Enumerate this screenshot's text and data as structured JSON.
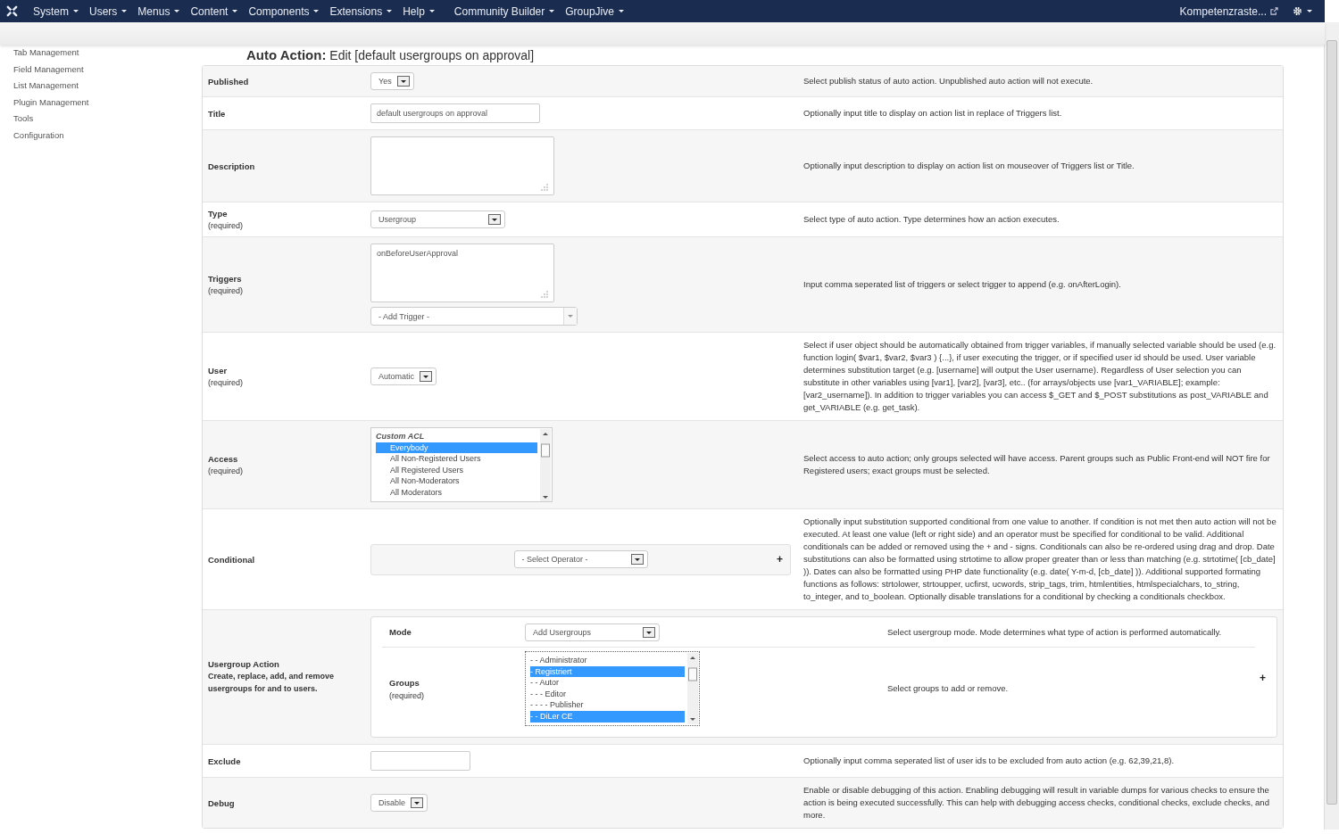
{
  "navbar": {
    "menus": [
      "System",
      "Users",
      "Menus",
      "Content",
      "Components",
      "Extensions",
      "Help",
      "Community Builder",
      "GroupJive"
    ],
    "site_link": "Kompetenzraste..."
  },
  "sidebar": {
    "items": [
      "Tab Management",
      "Field Management",
      "List Management",
      "Plugin Management",
      "Tools",
      "Configuration"
    ]
  },
  "page_title": "**Auto Action:** Edit [default usergroups on approval]",
  "rows": [
    {
      "kind": "select",
      "label": "Published",
      "value": "Yes",
      "help": "Select publish status of auto action. Unpublished auto action will not execute."
    },
    {
      "kind": "text",
      "label": "Title",
      "value": "default usergroups on approval",
      "help": "Optionally input title to display on action list in replace of Triggers list."
    },
    {
      "kind": "textarea",
      "label": "Description",
      "help": "Optionally input description to display on action list on mouseover of Triggers list or Title."
    },
    {
      "kind": "select",
      "label": "Type",
      "note": "(required)",
      "value": "Usergroup",
      "help": "Select type of auto action. Type determines how an action executes."
    },
    {
      "kind": "triggers",
      "label": "Triggers",
      "note": "(required)",
      "value": "onBeforeUserApproval",
      "select": "- Add Trigger -",
      "help": "Input comma seperated list of triggers or select trigger to append (e.g. onAfterLogin)."
    },
    {
      "kind": "select",
      "label": "User",
      "note": "(required)",
      "value": "Automatic",
      "help": "Select if user object should be automatically obtained from trigger variables, if manually selected variable should be used (e.g. function login( $var1, $var2, $var3 ) {...}, if user executing the trigger, or if specified user id should be used. User variable determines substitution target (e.g. [username] will output the User username). Regardless of User selection you can substitute in other variables using [var1], [var2], [var3], etc.. (for arrays/objects use [var1_VARIABLE]; example: [var2_username]). In addition to trigger variables you can access $_GET and $_POST substitutions as post_VARIABLE and get_VARIABLE (e.g. get_task)."
    },
    {
      "kind": "listbox",
      "label": "Access",
      "note": "(required)",
      "options": [
        {
          "text": "Custom ACL",
          "kind": "group",
          "selected": false
        },
        {
          "text": "Everybody",
          "kind": "option",
          "selected": true
        },
        {
          "text": "All Non-Registered Users",
          "kind": "option",
          "selected": false
        },
        {
          "text": "All Registered Users",
          "kind": "option",
          "selected": false
        },
        {
          "text": "All Non-Moderators",
          "kind": "option",
          "selected": false
        },
        {
          "text": "All Moderators",
          "kind": "option",
          "selected": false
        }
      ],
      "help": "Select access to auto action; only groups selected will have access. Parent groups such as Public Front-end will NOT fire for Registered users; exact groups must be selected."
    },
    {
      "kind": "conditional",
      "label": "Conditional",
      "value": "- Select Operator -",
      "add": "+",
      "help": "Optionally input substitution supported conditional from one value to another. If condition is not met then auto action will not be executed. At least one value (left or right side) and an operator must be specified for conditional to be valid. Additional conditionals can be added or removed using the + and - signs. Conditionals can also be re-ordered using drag and drop. Date substitutions can also be formatted using strtotime to allow proper greater than or less than matching (e.g. strtotime( [cb_date] )). Dates can also be formatted using PHP date functionality (e.g. date( Y-m-d, [cb_date] )). Additional supported formating functions as follows: strtolower, strtoupper, ucfirst, ucwords, strip_tags, trim, htmlentities, htmlspecialchars, to_string, to_integer, and to_boolean. Optionally disable translations for a conditional by checking a conditionals checkbox."
    },
    {
      "kind": "usergroup",
      "label": "Usergroup Action",
      "note": "Create, replace, add, and remove usergroups for and to users.",
      "add": "+",
      "mode": {
        "label": "Mode",
        "value": "Add Usergroups",
        "help": "Select usergroup mode. Mode determines what type of action is performed automatically."
      },
      "groups": {
        "label": "Groups",
        "note": "(required)",
        "help": "Select groups to add or remove.",
        "options": [
          {
            "text": "- - Administrator",
            "selected": false
          },
          {
            "text": "- Registriert",
            "selected": true
          },
          {
            "text": "- - Autor",
            "selected": false
          },
          {
            "text": "- - - Editor",
            "selected": false
          },
          {
            "text": "- - - - Publisher",
            "selected": false
          },
          {
            "text": "- - DiLer CE",
            "selected": true
          }
        ]
      }
    },
    {
      "kind": "text",
      "label": "Exclude",
      "value": "",
      "help": "Optionally input comma seperated list of user ids to be excluded from auto action (e.g. 62,39,21,8)."
    },
    {
      "kind": "select",
      "label": "Debug",
      "value": "Disable",
      "help": "Enable or disable debugging of this action. Enabling debugging will result in variable dumps for various checks to ensure the action is being executed successfully. This can help with debugging access checks, conditional checks, exclude checks, and more."
    }
  ]
}
